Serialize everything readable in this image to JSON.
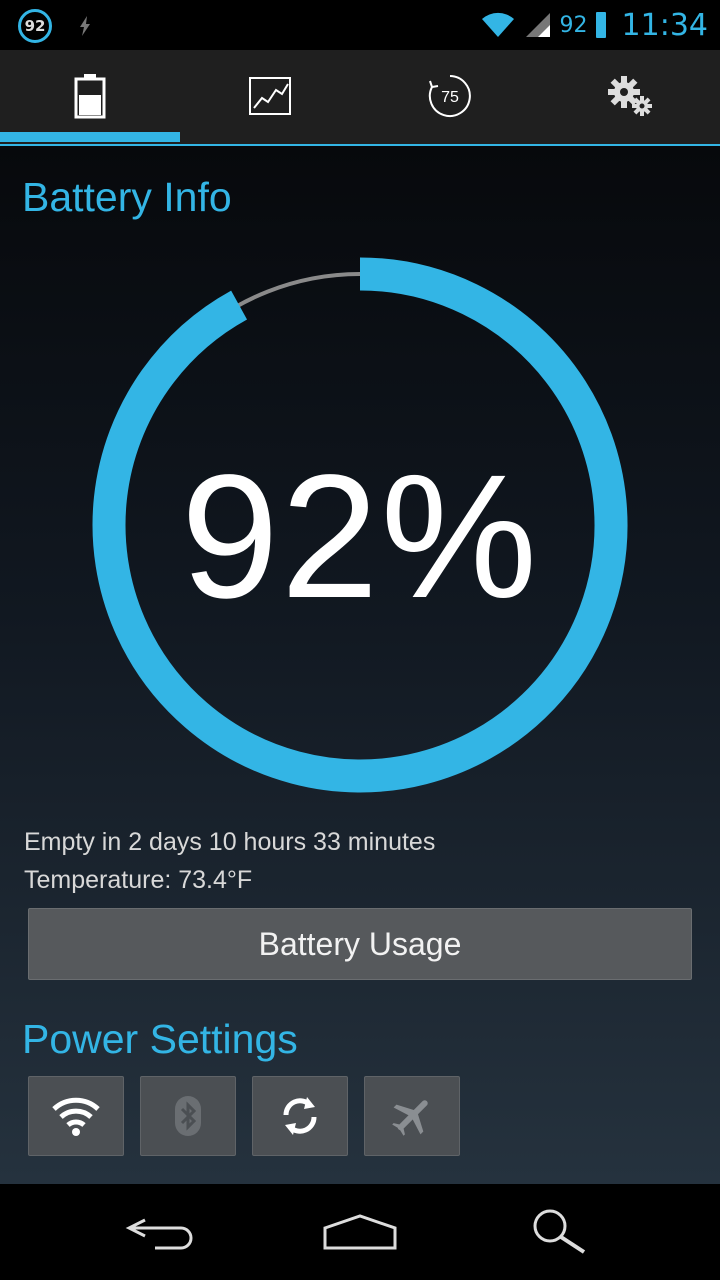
{
  "status_bar": {
    "badge_level": "92",
    "battery_level": "92",
    "time": "11:34"
  },
  "tabs": [
    {
      "name": "battery-icon",
      "active": true
    },
    {
      "name": "graph-icon",
      "active": false
    },
    {
      "name": "timer-icon",
      "label": "75",
      "active": false
    },
    {
      "name": "gears-icon",
      "active": false
    }
  ],
  "battery_info": {
    "title": "Battery Info",
    "level_text": "92%",
    "level_fraction": 0.92,
    "empty_in": "Empty in 2 days 10 hours 33 minutes",
    "temperature": "Temperature: 73.4°F",
    "usage_button_label": "Battery Usage"
  },
  "power_settings": {
    "title": "Power Settings",
    "toggles": [
      {
        "name": "wifi-icon",
        "on": true
      },
      {
        "name": "bluetooth-icon",
        "on": false
      },
      {
        "name": "sync-icon",
        "on": true
      },
      {
        "name": "airplane-icon",
        "on": false
      }
    ]
  },
  "colors": {
    "accent": "#33b5e5",
    "track": "#8a8a8a"
  },
  "nav": [
    "back-icon",
    "home-icon",
    "search-icon"
  ]
}
